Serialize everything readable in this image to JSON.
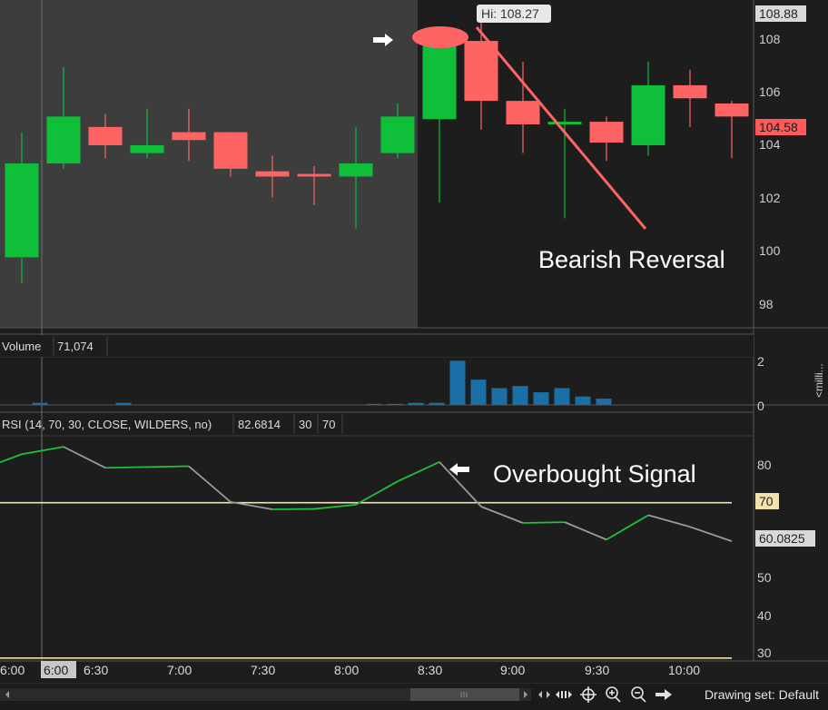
{
  "price_panel": {
    "hi_label": "Hi: 108.27",
    "top_price_tag": "108.88",
    "last_price_tag": "104.58",
    "y_ticks": [
      "108",
      "106",
      "104",
      "102",
      "100",
      "98"
    ],
    "annotation": "Bearish Reversal"
  },
  "volume_panel": {
    "label": "Volume",
    "value": "71,074",
    "y_ticks": [
      "2",
      "0"
    ],
    "side_label": "<milli..."
  },
  "rsi_panel": {
    "label": "RSI (14, 70, 30, CLOSE, WILDERS, no)",
    "value": "82.6814",
    "oversold": "30",
    "overbought": "70",
    "y_ticks": [
      "80",
      "70",
      "60.0825",
      "50",
      "40",
      "30"
    ],
    "annotation": "Overbought Signal"
  },
  "time_axis": {
    "labels": [
      "6:00",
      "6:00",
      "6:30",
      "7:00",
      "7:30",
      "8:00",
      "8:30",
      "9:00",
      "9:30",
      "10:00"
    ]
  },
  "footer": {
    "drawing_set": "Drawing set: Default"
  },
  "colors": {
    "up": "#0fbf3a",
    "down": "#ff6464",
    "rsi_up": "#1fc03a",
    "rsi_down": "#9a9a9a",
    "level": "#f3e2a9",
    "volume": "#1a6fa6"
  },
  "chart_data": {
    "type": "candlestick",
    "candles": [
      {
        "o": 99.2,
        "h": 104.0,
        "l": 98.2,
        "c": 102.8
      },
      {
        "o": 102.8,
        "h": 106.5,
        "l": 102.6,
        "c": 104.6
      },
      {
        "o": 104.2,
        "h": 104.7,
        "l": 103.0,
        "c": 103.5
      },
      {
        "o": 103.2,
        "h": 104.9,
        "l": 103.0,
        "c": 103.5
      },
      {
        "o": 104.0,
        "h": 104.9,
        "l": 102.9,
        "c": 103.7
      },
      {
        "o": 104.0,
        "h": 104.0,
        "l": 102.3,
        "c": 102.6
      },
      {
        "o": 102.5,
        "h": 103.1,
        "l": 101.5,
        "c": 102.3
      },
      {
        "o": 102.4,
        "h": 102.7,
        "l": 101.2,
        "c": 102.3
      },
      {
        "o": 102.3,
        "h": 104.2,
        "l": 100.3,
        "c": 102.8
      },
      {
        "o": 103.2,
        "h": 105.1,
        "l": 103.0,
        "c": 104.6
      },
      {
        "o": 104.5,
        "h": 108.0,
        "l": 101.3,
        "c": 107.4
      },
      {
        "o": 107.5,
        "h": 108.27,
        "l": 104.1,
        "c": 105.2
      },
      {
        "o": 105.2,
        "h": 106.7,
        "l": 103.2,
        "c": 104.3
      },
      {
        "o": 104.3,
        "h": 104.9,
        "l": 100.7,
        "c": 104.4
      },
      {
        "o": 104.4,
        "h": 104.6,
        "l": 102.9,
        "c": 103.6
      },
      {
        "o": 103.5,
        "h": 106.7,
        "l": 103.1,
        "c": 105.8
      },
      {
        "o": 105.8,
        "h": 106.4,
        "l": 104.2,
        "c": 105.3
      },
      {
        "o": 105.1,
        "h": 105.2,
        "l": 103.0,
        "c": 104.6
      }
    ],
    "volume": [
      0,
      0.1,
      0,
      0,
      0,
      0.1,
      0,
      0,
      0,
      0,
      0,
      0,
      0,
      0,
      0,
      0,
      0,
      0.05,
      0.05,
      0.1,
      0.1,
      2.1,
      1.2,
      0.8,
      0.9,
      0.6,
      0.8,
      0.4,
      0.3
    ],
    "rsi": [
      78.5,
      82.5,
      84.4,
      79.0,
      79.2,
      79.4,
      70.2,
      68.3,
      68.4,
      69.5,
      75.5,
      80.5,
      69.0,
      64.8,
      65.0,
      60.5,
      66.8,
      63.8,
      60.0825
    ],
    "rsi_levels": [
      70,
      30
    ],
    "ylim_price": [
      96.5,
      109
    ],
    "ylim_rsi": [
      29.5,
      87
    ]
  }
}
